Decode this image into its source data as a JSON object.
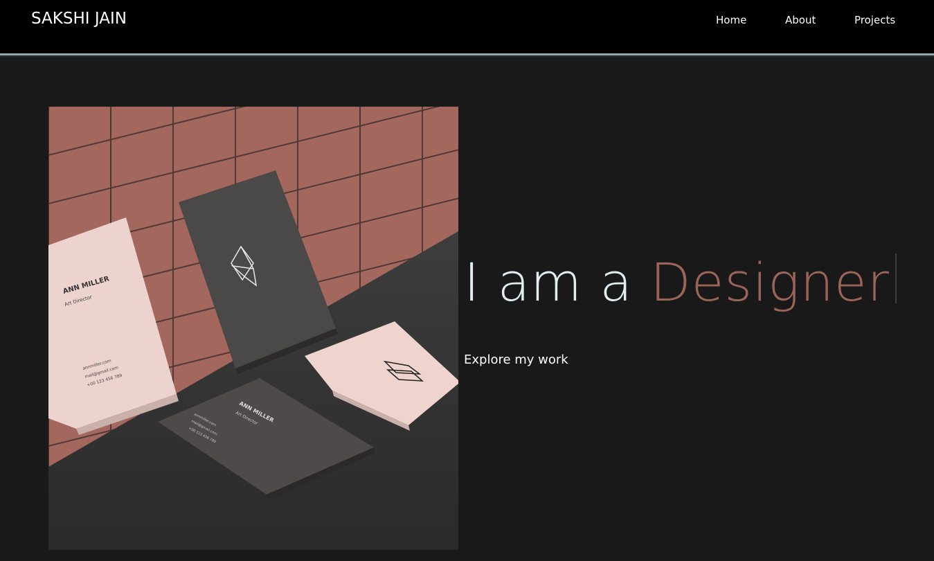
{
  "header": {
    "site_title": "SAKSHI JAIN",
    "nav": {
      "home": "Home",
      "about": "About",
      "projects": "Projects"
    }
  },
  "hero": {
    "image_alt": "Business card mockup",
    "card_text": {
      "name": "ANN MILLER",
      "role": "Art Director",
      "website": "annmiller.com",
      "email": "mail@gmail.com",
      "phone": "+00 123 456 789"
    },
    "headline_prefix": "I am a",
    "headline_word": "Designer",
    "explore_label": "Explore my work"
  },
  "colors": {
    "background": "#191919",
    "header": "#000000",
    "header_line": "#8ea4b0",
    "headline_prefix": "#e3eef2",
    "headline_accent": "#9a6558"
  }
}
